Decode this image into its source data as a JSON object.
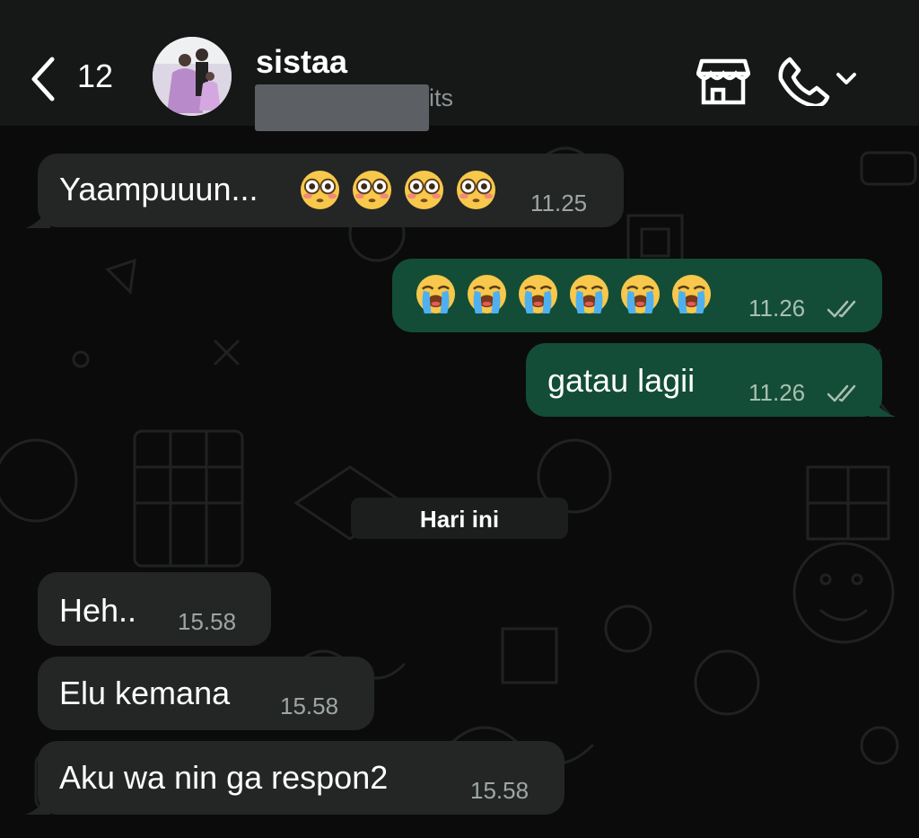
{
  "header": {
    "back_count": "12",
    "contact_name": "sistaa",
    "contact_status": "its"
  },
  "messages": [
    {
      "direction": "in",
      "text": "Yaampuuun...",
      "emoji": [
        "flushed-face",
        "flushed-face",
        "flushed-face",
        "flushed-face"
      ],
      "time": "11.25"
    },
    {
      "direction": "out",
      "emoji": [
        "loudly-crying-face",
        "loudly-crying-face",
        "loudly-crying-face",
        "loudly-crying-face",
        "loudly-crying-face",
        "loudly-crying-face"
      ],
      "time": "11.26",
      "status": "read"
    },
    {
      "direction": "out",
      "text": "gatau lagii",
      "time": "11.26",
      "status": "read"
    },
    {
      "direction": "in",
      "text": "Heh..",
      "time": "15.58"
    },
    {
      "direction": "in",
      "text": "Elu kemana",
      "time": "15.58"
    },
    {
      "direction": "in",
      "text": "Aku wa nin ga respon2",
      "time": "15.58"
    }
  ],
  "date_separator": "Hari ini",
  "colors": {
    "header_bg": "#161717",
    "incoming_bubble": "#242626",
    "outgoing_bubble": "#134d37",
    "chat_bg": "#0b0b0b"
  }
}
